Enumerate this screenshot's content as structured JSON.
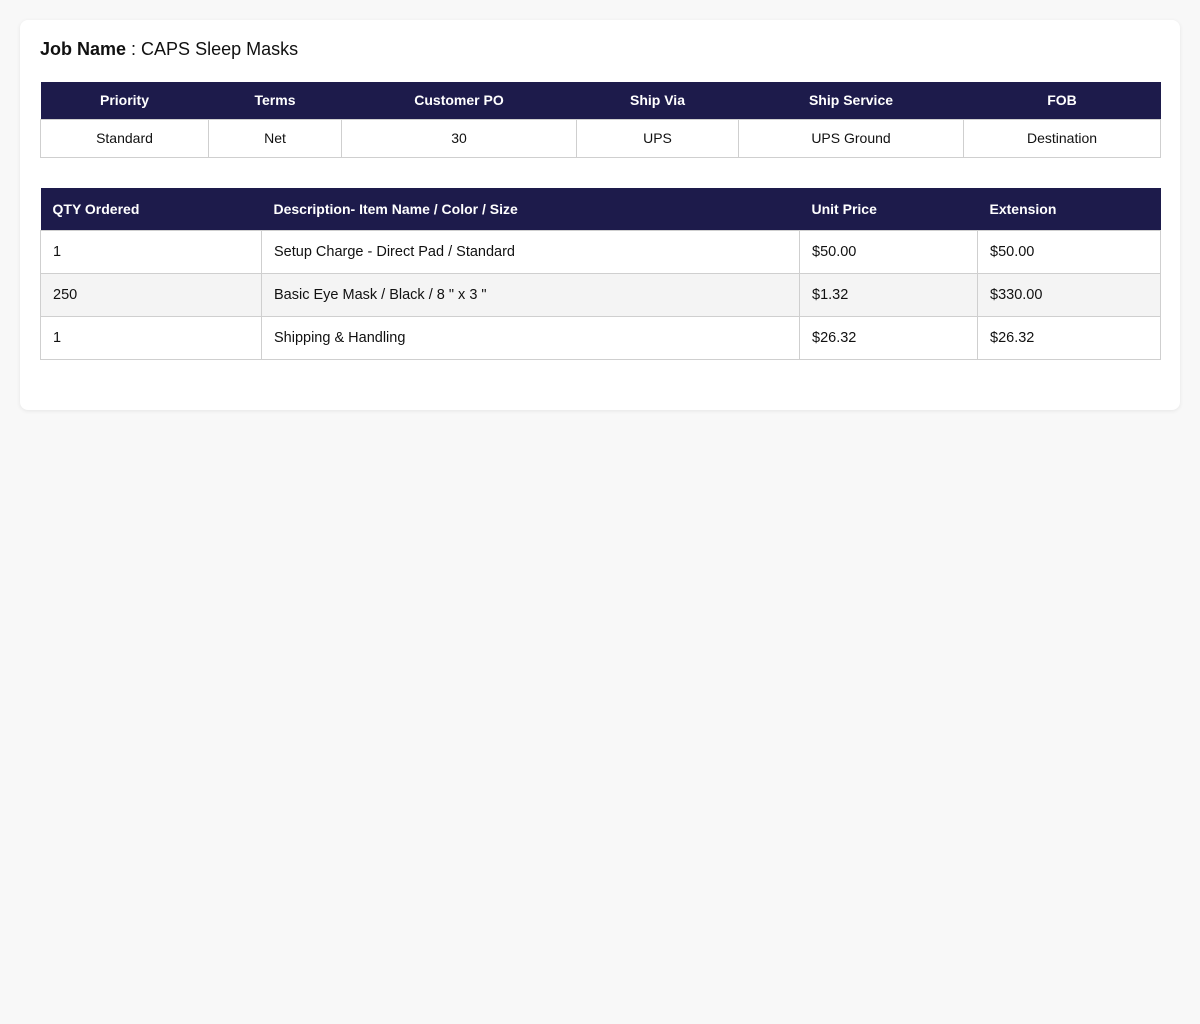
{
  "job": {
    "label": "Job Name",
    "separator": " : ",
    "value": "CAPS Sleep Masks"
  },
  "order_info": {
    "headers": [
      "Priority",
      "Terms",
      "Customer PO",
      "Ship Via",
      "Ship Service",
      "FOB"
    ],
    "values": [
      "Standard",
      "Net",
      "30",
      "UPS",
      "UPS Ground",
      "Destination"
    ]
  },
  "line_items": {
    "headers": [
      "QTY Ordered",
      "Description- Item Name / Color / Size",
      "Unit Price",
      "Extension"
    ],
    "rows": [
      [
        "1",
        "Setup Charge - Direct Pad / Standard",
        "$50.00",
        "$50.00"
      ],
      [
        "250",
        "Basic Eye Mask / Black / 8 \" x 3 \"",
        "$1.32",
        "$330.00"
      ],
      [
        "1",
        "Shipping & Handling",
        "$26.32",
        "$26.32"
      ]
    ]
  },
  "colors": {
    "header_bg": "#1d1b4b",
    "page_bg": "#f8f8f8",
    "alt_row_bg": "#f4f4f4"
  }
}
